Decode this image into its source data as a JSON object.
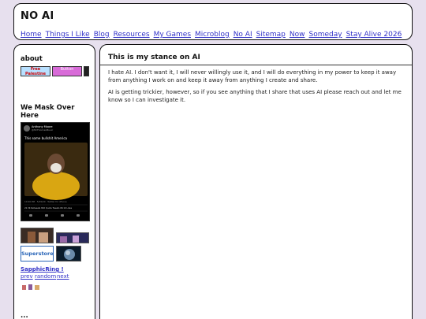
{
  "header": {
    "title": "NO AI",
    "nav": [
      "Home",
      "Things I Like",
      "Blog",
      "Resources",
      "My Games",
      "Microblog",
      "No AI",
      "Sitemap",
      "Now",
      "Someday",
      "Stay Alive 2026"
    ]
  },
  "sidebar": {
    "about_title": "about",
    "badges": [
      "Free Palestine Now!!!",
      "Button",
      ""
    ],
    "mask_title": "We Mask Over Here",
    "tweet": {
      "author": "Anthony Moore",
      "handle": "@MrThomasMusic",
      "text": "This some bullshit America",
      "time": "10:26 PM · 5/29/20 · Twitter for iPhone",
      "stats": "22.3K Retweets  802 Quote Tweets  68.1K Likes"
    },
    "thumb_labels": [
      "",
      "",
      "Superstore",
      ""
    ],
    "ring_title": "SapphicRing !",
    "ring_links": [
      "prev",
      "random",
      "next"
    ],
    "bottom_title": "..."
  },
  "main": {
    "heading": "This is my stance on AI",
    "paragraphs": [
      "I hate AI. I don't want it, I will never willingly use it, and I will do everything in my power to keep it away from anything I work on and keep it away from anything I create and share.",
      "AI is getting trickier, however, so if you see anything that I share that uses AI please reach out and let me know so I can investigate it."
    ]
  },
  "colors": {
    "background": "#e7e0ee",
    "link": "#3232c8",
    "border": "#111111"
  }
}
